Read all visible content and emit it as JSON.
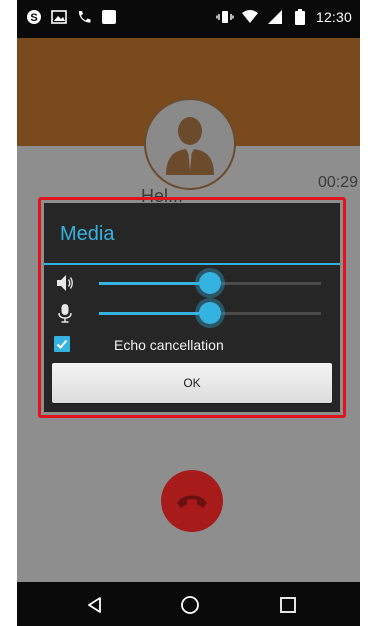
{
  "status_bar": {
    "time": "12:30",
    "left_icons": [
      "skype-icon",
      "image-icon",
      "phone-icon",
      "square-notification-icon"
    ],
    "right_icons": [
      "vibrate-icon",
      "wifi-icon",
      "signal-icon",
      "battery-icon"
    ]
  },
  "call": {
    "duration": "00:29",
    "peer_name": "Hel...",
    "avatar_icon": "person-icon",
    "hangup_icon": "hang-up-icon",
    "colors": {
      "header": "#7a4a1f",
      "hangup": "#a71b1b"
    }
  },
  "dialog": {
    "title": "Media",
    "speaker_volume": 0.5,
    "mic_volume": 0.5,
    "speaker_icon": "speaker-icon",
    "mic_icon": "microphone-icon",
    "echo_cancellation": {
      "label": "Echo cancellation",
      "checked": true
    },
    "ok_label": "OK",
    "accent": "#35b3e0"
  },
  "highlight_color": "#e0141b",
  "nav_bar": {
    "icons": [
      "back-icon",
      "home-icon",
      "recents-icon"
    ]
  }
}
